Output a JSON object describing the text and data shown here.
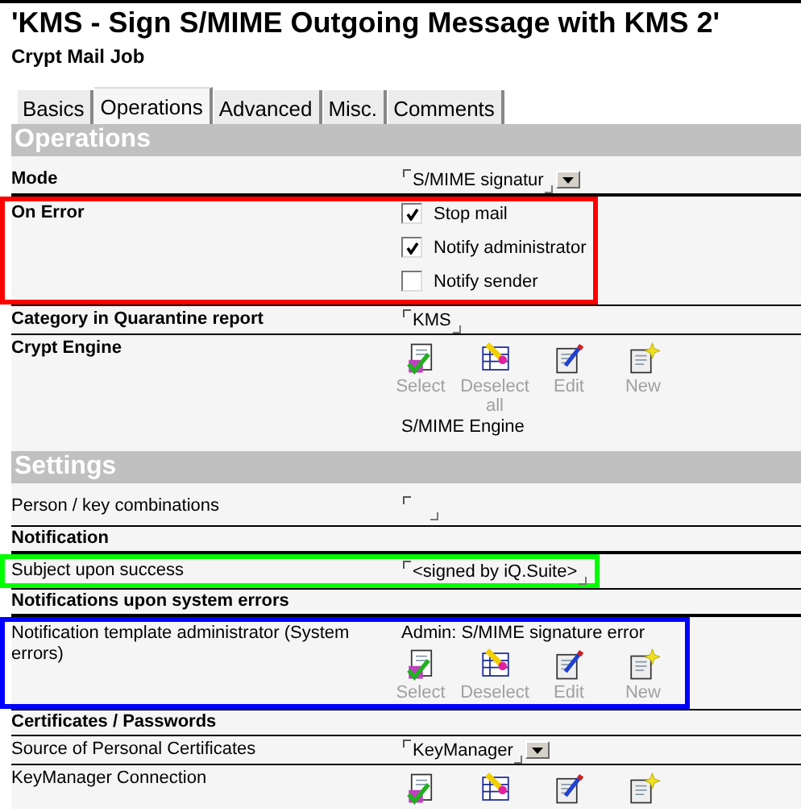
{
  "title": "'KMS - Sign S/MIME Outgoing Message with KMS 2'",
  "subtitle": "Crypt Mail Job",
  "tabs": [
    {
      "label": "Basics",
      "selected": false
    },
    {
      "label": "Operations",
      "selected": true
    },
    {
      "label": "Advanced",
      "selected": false
    },
    {
      "label": "Misc.",
      "selected": false
    },
    {
      "label": "Comments",
      "selected": false
    }
  ],
  "sections": [
    {
      "heading": "Operations",
      "bold_labels": true,
      "rows": [
        {
          "kind": "select",
          "label": "Mode",
          "value": "S/MIME signatur"
        },
        {
          "kind": "checkboxes",
          "label": "On Error",
          "color": "#ff0000",
          "options": [
            {
              "label": "Stop mail",
              "checked": true
            },
            {
              "label": "Notify administrator",
              "checked": true
            },
            {
              "label": "Notify sender",
              "checked": false
            }
          ]
        },
        {
          "kind": "field",
          "label": "Category in Quarantine report",
          "value": "KMS"
        },
        {
          "kind": "actions",
          "label": "Crypt Engine",
          "footer": "S/MIME Engine",
          "buttons": [
            {
              "kind": "select",
              "label": "Select",
              "disabled": true
            },
            {
              "kind": "deselect",
              "label": "Deselect all",
              "disabled": true
            },
            {
              "kind": "edit",
              "label": "Edit",
              "disabled": true
            },
            {
              "kind": "new",
              "label": "New",
              "disabled": true
            }
          ]
        }
      ]
    },
    {
      "heading": "Settings",
      "bold_labels": false,
      "rows": [
        {
          "kind": "field",
          "label": "Person / key combinations"
        },
        {
          "kind": "subheading",
          "label": "Notification"
        },
        {
          "kind": "field",
          "label": "Subject upon success",
          "value": "<signed by iQ.Suite>",
          "color": "#00ff00"
        },
        {
          "kind": "subheading",
          "label": "Notifications upon system errors"
        },
        {
          "kind": "actions",
          "label": "Notification template administrator (System errors)",
          "header": "Admin: S/MIME signature error",
          "color": "#0000ff",
          "buttons": [
            {
              "kind": "select",
              "label": "Select",
              "disabled": true
            },
            {
              "kind": "deselect",
              "label": "Deselect",
              "disabled": true
            },
            {
              "kind": "edit",
              "label": "Edit",
              "disabled": true
            },
            {
              "kind": "new",
              "label": "New",
              "disabled": true
            }
          ]
        },
        {
          "kind": "subheading",
          "label": "Certificates / Passwords"
        },
        {
          "kind": "select",
          "label": "Source of Personal Certificates",
          "value": "KeyManager"
        },
        {
          "kind": "actions",
          "label": "KeyManager Connection",
          "buttons": [
            {
              "kind": "select"
            },
            {
              "kind": "deselect"
            },
            {
              "kind": "edit"
            },
            {
              "kind": "new"
            }
          ]
        }
      ]
    }
  ]
}
